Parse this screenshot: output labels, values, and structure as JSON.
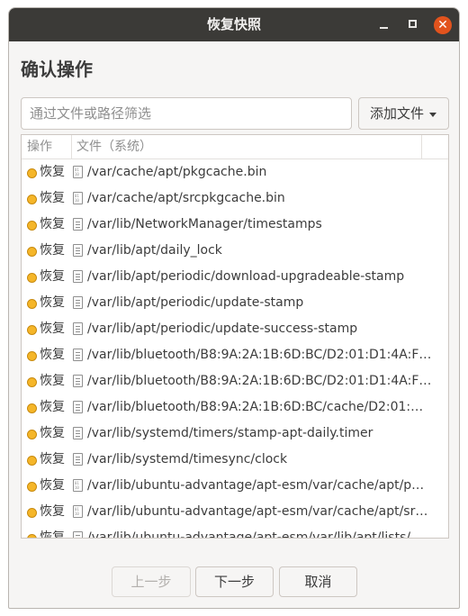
{
  "window": {
    "title": "恢复快照",
    "controls": {
      "minimize_icon": "minimize-icon",
      "maximize_icon": "maximize-icon",
      "close_icon": "close-icon",
      "close_glyph": "✕"
    }
  },
  "heading": "确认操作",
  "filter": {
    "placeholder": "通过文件或路径筛选",
    "value": ""
  },
  "add_file_button": {
    "label": "添加文件",
    "icon": "caret-down-icon"
  },
  "table": {
    "columns": [
      "操作",
      "文件（系统）"
    ],
    "rows": [
      {
        "action": "恢复",
        "file_type": "binary",
        "path": "/var/cache/apt/pkgcache.bin"
      },
      {
        "action": "恢复",
        "file_type": "binary",
        "path": "/var/cache/apt/srcpkgcache.bin"
      },
      {
        "action": "恢复",
        "file_type": "text",
        "path": "/var/lib/NetworkManager/timestamps"
      },
      {
        "action": "恢复",
        "file_type": "text",
        "path": "/var/lib/apt/daily_lock"
      },
      {
        "action": "恢复",
        "file_type": "text",
        "path": "/var/lib/apt/periodic/download-upgradeable-stamp"
      },
      {
        "action": "恢复",
        "file_type": "text",
        "path": "/var/lib/apt/periodic/update-stamp"
      },
      {
        "action": "恢复",
        "file_type": "text",
        "path": "/var/lib/apt/periodic/update-success-stamp"
      },
      {
        "action": "恢复",
        "file_type": "text",
        "path": "/var/lib/bluetooth/B8:9A:2A:1B:6D:BC/D2:01:D1:4A:F…"
      },
      {
        "action": "恢复",
        "file_type": "text",
        "path": "/var/lib/bluetooth/B8:9A:2A:1B:6D:BC/D2:01:D1:4A:F…"
      },
      {
        "action": "恢复",
        "file_type": "text",
        "path": "/var/lib/bluetooth/B8:9A:2A:1B:6D:BC/cache/D2:01:…"
      },
      {
        "action": "恢复",
        "file_type": "text",
        "path": "/var/lib/systemd/timers/stamp-apt-daily.timer"
      },
      {
        "action": "恢复",
        "file_type": "text",
        "path": "/var/lib/systemd/timesync/clock"
      },
      {
        "action": "恢复",
        "file_type": "binary",
        "path": "/var/lib/ubuntu-advantage/apt-esm/var/cache/apt/p…"
      },
      {
        "action": "恢复",
        "file_type": "binary",
        "path": "/var/lib/ubuntu-advantage/apt-esm/var/cache/apt/sr…"
      },
      {
        "action": "恢复",
        "file_type": "text",
        "path": "/var/lib/ubuntu-advantage/apt-esm/var/lib/apt/lists/…"
      }
    ]
  },
  "footer": {
    "back_label": "上一步",
    "next_label": "下一步",
    "cancel_label": "取消"
  },
  "colors": {
    "titlebar": "#3b3a37",
    "close_button": "#e2531d",
    "status_dot": "#f5b629"
  }
}
